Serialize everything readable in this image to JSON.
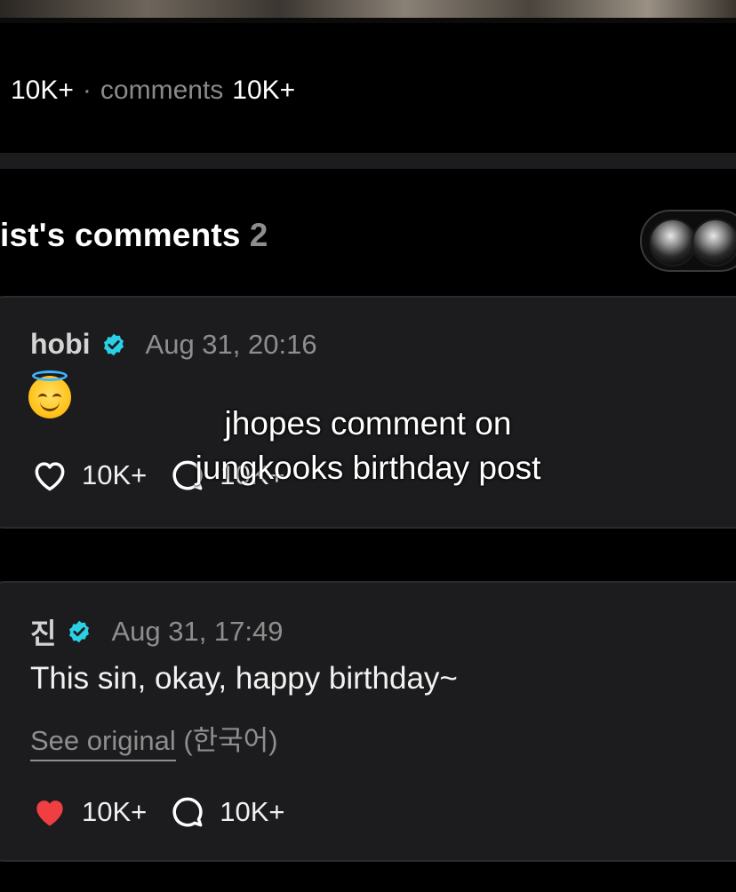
{
  "stats": {
    "likes": "10K+",
    "separator": "·",
    "comments_label": "comments",
    "comments_count": "10K+"
  },
  "section": {
    "title": "ist's comments",
    "count": "2"
  },
  "comments": [
    {
      "author": "hobi",
      "time": "Aug 31, 20:16",
      "emoji": "smiling-face-with-halo",
      "likes": "10K+",
      "replies": "10K+",
      "liked": false
    },
    {
      "author": "진",
      "time": "Aug 31, 17:49",
      "text": "This sin, okay, happy birthday~",
      "see_original": "See original",
      "language": "(한국어)",
      "likes": "10K+",
      "replies": "10K+",
      "liked": true
    }
  ],
  "overlay": {
    "line1": "jhopes comment on",
    "line2": "jungkooks birthday post"
  },
  "colors": {
    "background": "#000000",
    "card": "#1c1c1e",
    "verified": "#2ad1e6",
    "liked_heart": "#ef3f42",
    "muted": "#8e8e8e"
  }
}
